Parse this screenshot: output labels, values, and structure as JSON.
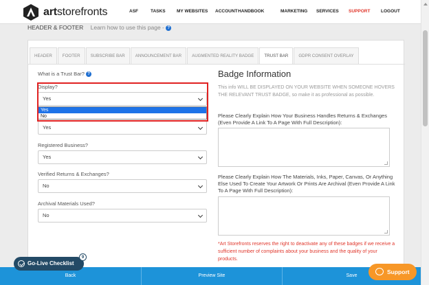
{
  "brand": {
    "name_bold": "art",
    "name_rest": "storefronts"
  },
  "nav": [
    {
      "label": "ASF",
      "active": false
    },
    {
      "label": "TASKS",
      "active": false
    },
    {
      "label": "MY WEBSITES",
      "active": false
    },
    {
      "label": "ACCOUNT",
      "active": false
    },
    {
      "label": "HANDBOOK",
      "active": false
    },
    {
      "label": "MARKETING",
      "active": false
    },
    {
      "label": "SERVICES",
      "active": false
    },
    {
      "label": "SUPPORT",
      "active": true
    },
    {
      "label": "LOGOUT",
      "active": false
    }
  ],
  "header": {
    "title": "HEADER & FOOTER",
    "learn": "Learn how to use this page -",
    "help_icon": "?"
  },
  "tabs": [
    {
      "label": "HEADER",
      "active": false
    },
    {
      "label": "FOOTER",
      "active": false
    },
    {
      "label": "SUBSCRIBE BAR",
      "active": false
    },
    {
      "label": "ANNOUNCEMENT BAR",
      "active": false
    },
    {
      "label": "AUGMENTED REALITY BADGE",
      "active": false
    },
    {
      "label": "TRUST BAR",
      "active": true
    },
    {
      "label": "GDPR CONSENT OVERLAY",
      "active": false
    }
  ],
  "form": {
    "what_is": "What is a Trust Bar?",
    "display_label": "Display?",
    "display_value": "Yes",
    "display_options": [
      "Yes",
      "No"
    ],
    "display_highlighted": "Yes",
    "hidden_field_value": "Yes",
    "registered_label": "Registered Business?",
    "registered_value": "Yes",
    "returns_label": "Verified Returns & Exchanges?",
    "returns_value": "No",
    "archival_label": "Archival Materials Used?",
    "archival_value": "No"
  },
  "badge": {
    "title": "Badge Information",
    "intro": "This info WILL BE DISPLAYED ON YOUR WEBSITE WHEN SOMEONE HOVERS THE RELEVANT TRUST BADGE, so make it as professional as possible.",
    "q1": "Please Clearly Explain How Your Business Handles Returns & Exchanges (Even Provide A Link To A Page With Full Description):",
    "q1_value": "",
    "q2": "Please Clearly Explain How The Materials, Inks, Paper, Canvas, Or Anything Else Used To Create Your Artwork Or Prints Are Archival (Even Provide A Link To A Page With Full Description):",
    "q2_value": "",
    "disclaimer": "*Art Storefronts reserves the right to deactivate any of these badges if we receive a sufficient number of complaints about your business and the quality of your products."
  },
  "bottom": {
    "back": "Back",
    "preview": "Preview Site",
    "save": "Save"
  },
  "golive": {
    "label": "Go-Live Checklist",
    "count": "9"
  },
  "support": {
    "label": "Support"
  },
  "colors": {
    "accent_red": "#e0362b",
    "bottom_bar": "#1d93d9",
    "support_orange": "#f79727",
    "golive_navy": "#234a66"
  }
}
